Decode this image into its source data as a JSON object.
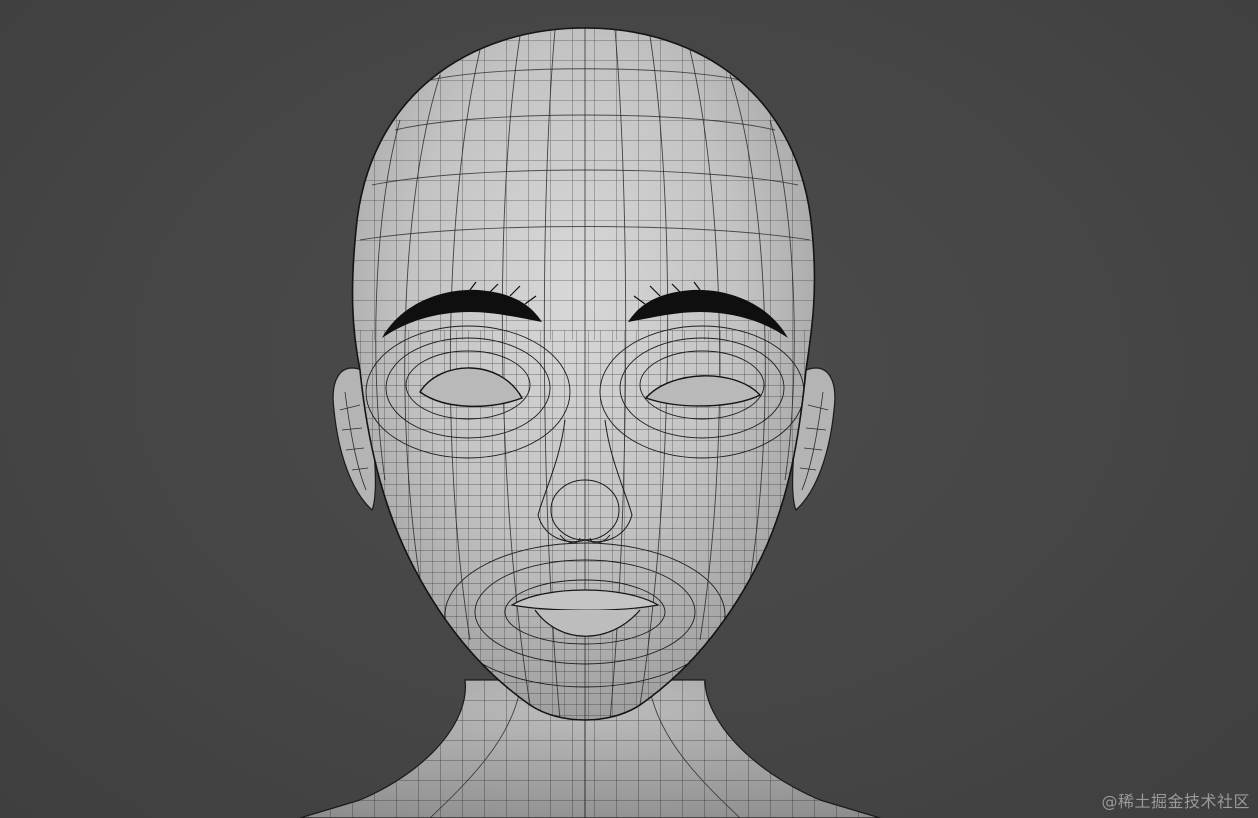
{
  "viewport": {
    "background_color": "#474747",
    "mesh_surface_color": "#c9c9c9",
    "wire_color": "#1e1e1e",
    "eyebrow_color": "#0f0f0f"
  },
  "model": {
    "subject": "wireframe-head-mesh"
  },
  "watermark": {
    "text": "@稀土掘金技术社区"
  }
}
